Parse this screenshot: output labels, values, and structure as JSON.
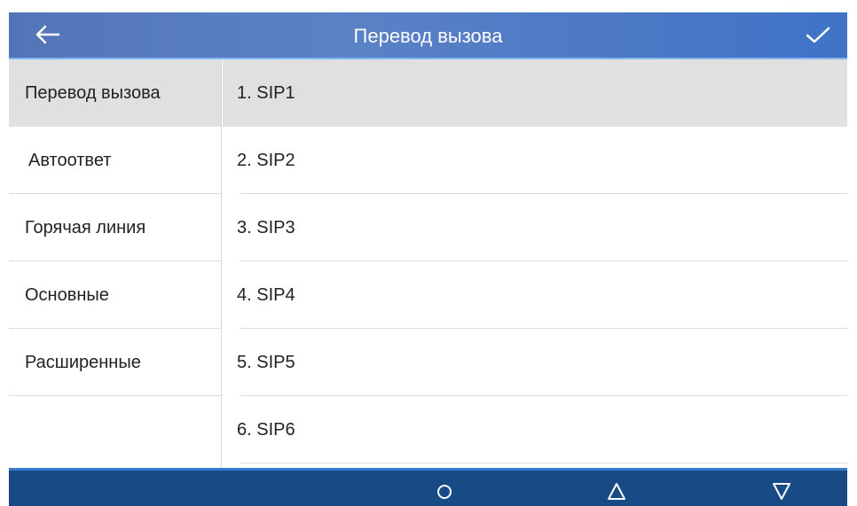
{
  "header": {
    "title": "Перевод вызова",
    "back_icon": "arrow-left-icon",
    "confirm_icon": "checkmark-icon"
  },
  "sidebar": {
    "items": [
      {
        "label": "Перевод вызова",
        "active": true
      },
      {
        "label": "Автоответ",
        "active": false
      },
      {
        "label": "Горячая линия",
        "active": false
      },
      {
        "label": "Основные",
        "active": false
      },
      {
        "label": "Расширенные",
        "active": false
      }
    ]
  },
  "main": {
    "items": [
      {
        "label": "1.  SIP1",
        "selected": true
      },
      {
        "label": "2.  SIP2",
        "selected": false
      },
      {
        "label": "3.  SIP3",
        "selected": false
      },
      {
        "label": "4.  SIP4",
        "selected": false
      },
      {
        "label": "5.  SIP5",
        "selected": false
      },
      {
        "label": "6.  SIP6",
        "selected": false
      }
    ]
  },
  "navbar": {
    "home_icon": "circle-icon",
    "up_icon": "triangle-up-icon",
    "down_icon": "triangle-down-icon"
  },
  "colors": {
    "header_bg": "#5b82c6",
    "navbar_bg": "#184b86",
    "selected_bg": "#e0e0e0",
    "text": "#222222"
  }
}
